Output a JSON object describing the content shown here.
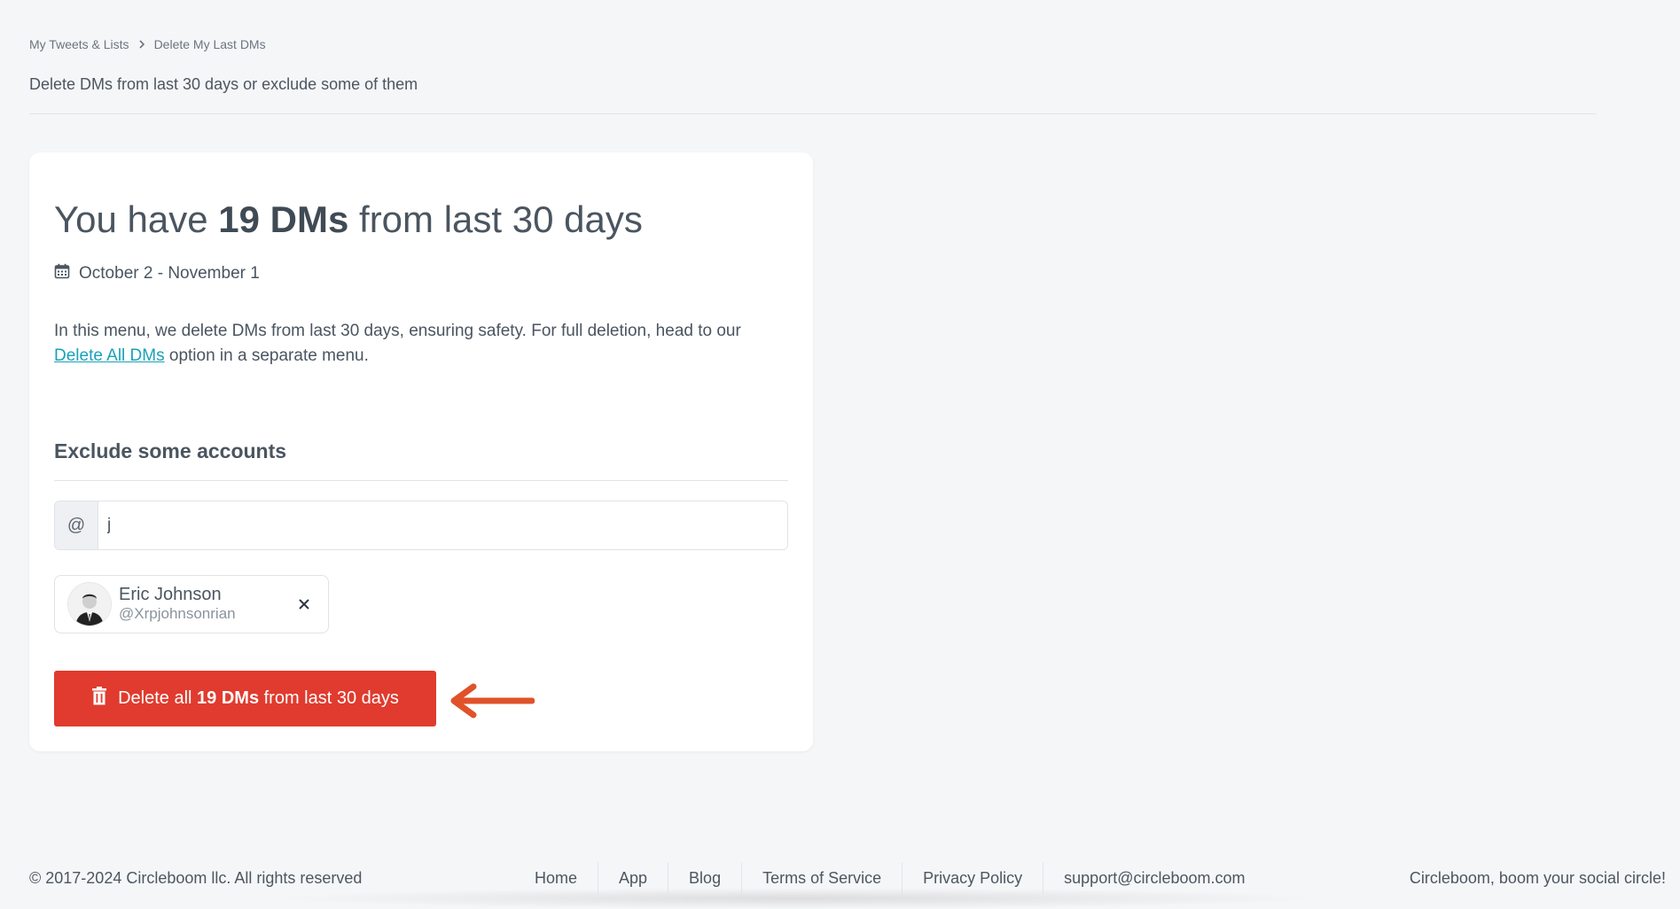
{
  "breadcrumb": {
    "parent": "My Tweets & Lists",
    "current": "Delete My Last DMs"
  },
  "subtitle": "Delete DMs from last 30 days or exclude some of them",
  "card": {
    "headline_prefix": "You have ",
    "headline_count": "19 DMs",
    "headline_suffix": " from last 30 days",
    "date_range": "October 2 - November 1",
    "desc_line1": "In this menu, we delete DMs from last 30 days, ensuring safety. For full deletion, head to our",
    "desc_link": "Delete All DMs",
    "desc_line2": " option in a separate menu.",
    "exclude_title": "Exclude some accounts",
    "input_prefix": "@",
    "input_value": "j",
    "excluded_user": {
      "name": "Eric Johnson",
      "handle": "@Xrpjohnsonrian"
    },
    "delete_button": {
      "prefix": "Delete all ",
      "count": "19 DMs",
      "suffix": " from last 30 days"
    }
  },
  "colors": {
    "danger": "#e03b2e",
    "link": "#17a2b8",
    "arrow": "#e0522a"
  },
  "footer": {
    "copyright": "© 2017-2024 Circleboom llc. All rights reserved",
    "links": [
      "Home",
      "App",
      "Blog",
      "Terms of Service",
      "Privacy Policy",
      "support@circleboom.com"
    ],
    "tagline": "Circleboom, boom your social circle!"
  }
}
